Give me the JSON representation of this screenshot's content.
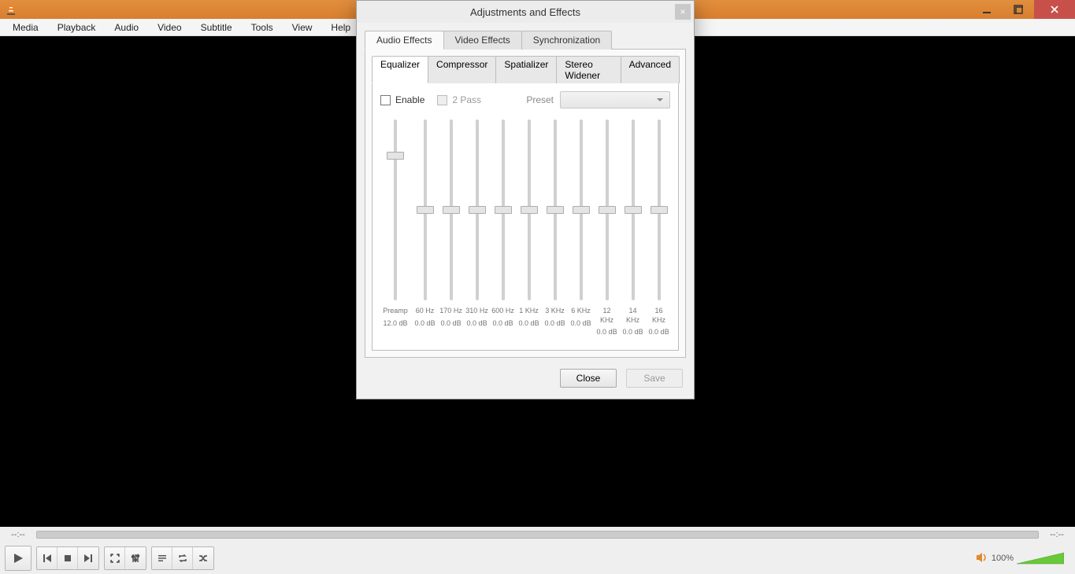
{
  "menubar": [
    "Media",
    "Playback",
    "Audio",
    "Video",
    "Subtitle",
    "Tools",
    "View",
    "Help"
  ],
  "time": {
    "left": "--:--",
    "right": "--:--"
  },
  "volume": {
    "percent": "100%"
  },
  "dialog": {
    "title": "Adjustments and Effects",
    "tabs": [
      "Audio Effects",
      "Video Effects",
      "Synchronization"
    ],
    "active_tab": 0,
    "subtabs": [
      "Equalizer",
      "Compressor",
      "Spatializer",
      "Stereo Widener",
      "Advanced"
    ],
    "active_subtab": 0,
    "enable_label": "Enable",
    "two_pass_label": "2 Pass",
    "preset_label": "Preset",
    "preamp": {
      "label": "Preamp",
      "value": "12.0 dB",
      "pos": 0.2
    },
    "bands": [
      {
        "freq": "60 Hz",
        "value": "0.0 dB",
        "pos": 0.5
      },
      {
        "freq": "170 Hz",
        "value": "0.0 dB",
        "pos": 0.5
      },
      {
        "freq": "310 Hz",
        "value": "0.0 dB",
        "pos": 0.5
      },
      {
        "freq": "600 Hz",
        "value": "0.0 dB",
        "pos": 0.5
      },
      {
        "freq": "1 KHz",
        "value": "0.0 dB",
        "pos": 0.5
      },
      {
        "freq": "3 KHz",
        "value": "0.0 dB",
        "pos": 0.5
      },
      {
        "freq": "6 KHz",
        "value": "0.0 dB",
        "pos": 0.5
      },
      {
        "freq": "12 KHz",
        "value": "0.0 dB",
        "pos": 0.5
      },
      {
        "freq": "14 KHz",
        "value": "0.0 dB",
        "pos": 0.5
      },
      {
        "freq": "16 KHz",
        "value": "0.0 dB",
        "pos": 0.5
      }
    ],
    "close_label": "Close",
    "save_label": "Save"
  }
}
